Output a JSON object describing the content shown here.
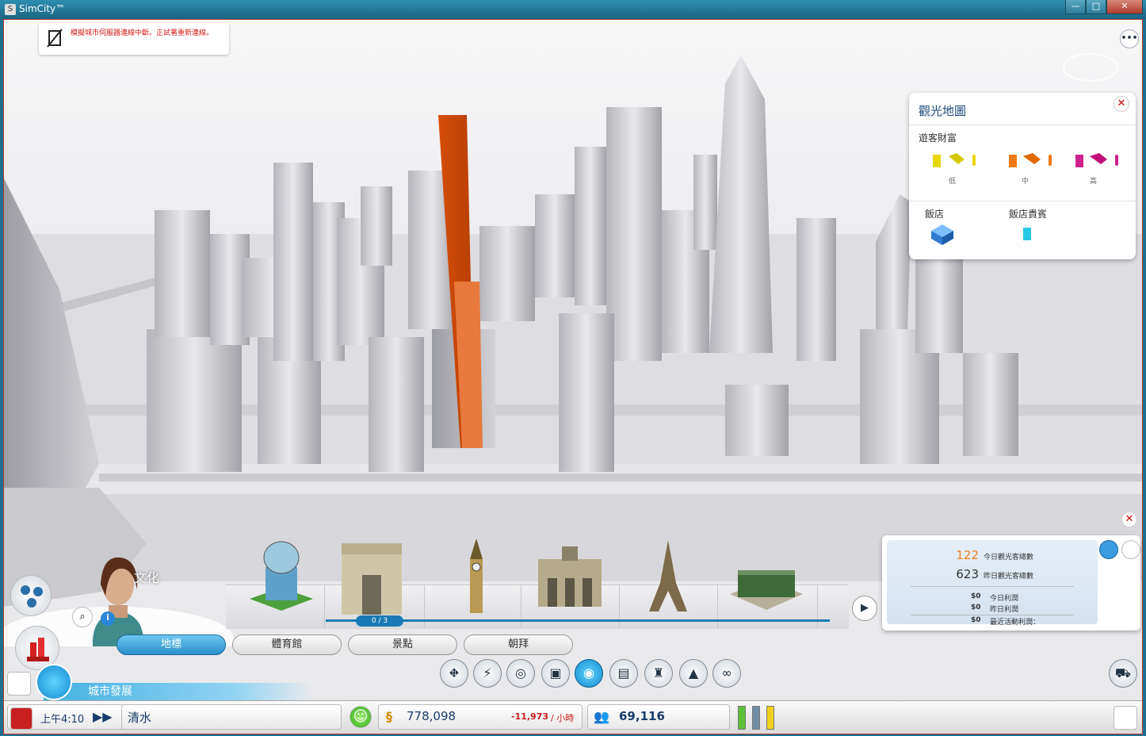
{
  "window": {
    "title": "SimCity™",
    "minimize": "—",
    "maximize": "□",
    "close": "✕"
  },
  "notification": {
    "text": "模擬城市伺服器連線中斷。正試著重新連線。"
  },
  "menu": {
    "label": "•••"
  },
  "tourism_panel": {
    "title": "觀光地圖",
    "close": "✕",
    "visitor_wealth_label": "遊客財富",
    "wealth_levels": [
      "低",
      "中",
      "高"
    ],
    "hotel_label": "飯店",
    "hotel_guest_label": "飯店貴賓",
    "colors": {
      "low": "#e8d800",
      "mid": "#f07a10",
      "high": "#d0208a",
      "hotel": "#3a8fe0",
      "guest": "#29c7e6"
    }
  },
  "advisor": {
    "label": "文化",
    "info": "i"
  },
  "build_tray": {
    "items": [
      "overhead-tower",
      "arc-de-triomphe",
      "big-ben",
      "brandenburg-like-gate",
      "eiffel-tower",
      "brandenburg-gate"
    ],
    "pager": "0 / 3",
    "next": "▶",
    "close": "✕"
  },
  "tabs": [
    {
      "label": "地標",
      "active": true
    },
    {
      "label": "體育館",
      "active": false
    },
    {
      "label": "景點",
      "active": false
    },
    {
      "label": "朝拜",
      "active": false
    }
  ],
  "stats": {
    "today_visitors": "122",
    "today_visitors_label": "今日觀光客總數",
    "yesterday_visitors": "623",
    "yesterday_visitors_label": "昨日觀光客總數",
    "today_profit": "$0",
    "today_profit_label": "今日利潤",
    "yesterday_profit": "$0",
    "yesterday_profit_label": "昨日利潤",
    "recent_profit": "$0",
    "recent_profit_label": "最近活動利潤："
  },
  "city_dev": {
    "label": "城市發展"
  },
  "status": {
    "time": "上午4:10",
    "city": "清水",
    "funds": "778,098",
    "rate": "-11,973",
    "per_hour": "/ 小時",
    "population": "69,116",
    "funds_icon": "§",
    "mood_icon": "☺"
  }
}
